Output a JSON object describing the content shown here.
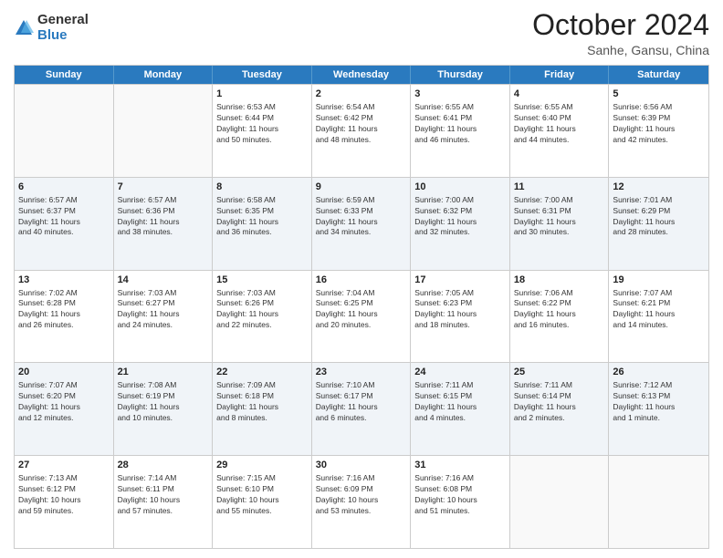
{
  "header": {
    "logo_general": "General",
    "logo_blue": "Blue",
    "month": "October 2024",
    "location": "Sanhe, Gansu, China"
  },
  "weekdays": [
    "Sunday",
    "Monday",
    "Tuesday",
    "Wednesday",
    "Thursday",
    "Friday",
    "Saturday"
  ],
  "rows": [
    [
      {
        "day": "",
        "lines": [],
        "empty": true
      },
      {
        "day": "",
        "lines": [],
        "empty": true
      },
      {
        "day": "1",
        "lines": [
          "Sunrise: 6:53 AM",
          "Sunset: 6:44 PM",
          "Daylight: 11 hours",
          "and 50 minutes."
        ]
      },
      {
        "day": "2",
        "lines": [
          "Sunrise: 6:54 AM",
          "Sunset: 6:42 PM",
          "Daylight: 11 hours",
          "and 48 minutes."
        ]
      },
      {
        "day": "3",
        "lines": [
          "Sunrise: 6:55 AM",
          "Sunset: 6:41 PM",
          "Daylight: 11 hours",
          "and 46 minutes."
        ]
      },
      {
        "day": "4",
        "lines": [
          "Sunrise: 6:55 AM",
          "Sunset: 6:40 PM",
          "Daylight: 11 hours",
          "and 44 minutes."
        ]
      },
      {
        "day": "5",
        "lines": [
          "Sunrise: 6:56 AM",
          "Sunset: 6:39 PM",
          "Daylight: 11 hours",
          "and 42 minutes."
        ]
      }
    ],
    [
      {
        "day": "6",
        "lines": [
          "Sunrise: 6:57 AM",
          "Sunset: 6:37 PM",
          "Daylight: 11 hours",
          "and 40 minutes."
        ]
      },
      {
        "day": "7",
        "lines": [
          "Sunrise: 6:57 AM",
          "Sunset: 6:36 PM",
          "Daylight: 11 hours",
          "and 38 minutes."
        ]
      },
      {
        "day": "8",
        "lines": [
          "Sunrise: 6:58 AM",
          "Sunset: 6:35 PM",
          "Daylight: 11 hours",
          "and 36 minutes."
        ]
      },
      {
        "day": "9",
        "lines": [
          "Sunrise: 6:59 AM",
          "Sunset: 6:33 PM",
          "Daylight: 11 hours",
          "and 34 minutes."
        ]
      },
      {
        "day": "10",
        "lines": [
          "Sunrise: 7:00 AM",
          "Sunset: 6:32 PM",
          "Daylight: 11 hours",
          "and 32 minutes."
        ]
      },
      {
        "day": "11",
        "lines": [
          "Sunrise: 7:00 AM",
          "Sunset: 6:31 PM",
          "Daylight: 11 hours",
          "and 30 minutes."
        ]
      },
      {
        "day": "12",
        "lines": [
          "Sunrise: 7:01 AM",
          "Sunset: 6:29 PM",
          "Daylight: 11 hours",
          "and 28 minutes."
        ]
      }
    ],
    [
      {
        "day": "13",
        "lines": [
          "Sunrise: 7:02 AM",
          "Sunset: 6:28 PM",
          "Daylight: 11 hours",
          "and 26 minutes."
        ]
      },
      {
        "day": "14",
        "lines": [
          "Sunrise: 7:03 AM",
          "Sunset: 6:27 PM",
          "Daylight: 11 hours",
          "and 24 minutes."
        ]
      },
      {
        "day": "15",
        "lines": [
          "Sunrise: 7:03 AM",
          "Sunset: 6:26 PM",
          "Daylight: 11 hours",
          "and 22 minutes."
        ]
      },
      {
        "day": "16",
        "lines": [
          "Sunrise: 7:04 AM",
          "Sunset: 6:25 PM",
          "Daylight: 11 hours",
          "and 20 minutes."
        ]
      },
      {
        "day": "17",
        "lines": [
          "Sunrise: 7:05 AM",
          "Sunset: 6:23 PM",
          "Daylight: 11 hours",
          "and 18 minutes."
        ]
      },
      {
        "day": "18",
        "lines": [
          "Sunrise: 7:06 AM",
          "Sunset: 6:22 PM",
          "Daylight: 11 hours",
          "and 16 minutes."
        ]
      },
      {
        "day": "19",
        "lines": [
          "Sunrise: 7:07 AM",
          "Sunset: 6:21 PM",
          "Daylight: 11 hours",
          "and 14 minutes."
        ]
      }
    ],
    [
      {
        "day": "20",
        "lines": [
          "Sunrise: 7:07 AM",
          "Sunset: 6:20 PM",
          "Daylight: 11 hours",
          "and 12 minutes."
        ]
      },
      {
        "day": "21",
        "lines": [
          "Sunrise: 7:08 AM",
          "Sunset: 6:19 PM",
          "Daylight: 11 hours",
          "and 10 minutes."
        ]
      },
      {
        "day": "22",
        "lines": [
          "Sunrise: 7:09 AM",
          "Sunset: 6:18 PM",
          "Daylight: 11 hours",
          "and 8 minutes."
        ]
      },
      {
        "day": "23",
        "lines": [
          "Sunrise: 7:10 AM",
          "Sunset: 6:17 PM",
          "Daylight: 11 hours",
          "and 6 minutes."
        ]
      },
      {
        "day": "24",
        "lines": [
          "Sunrise: 7:11 AM",
          "Sunset: 6:15 PM",
          "Daylight: 11 hours",
          "and 4 minutes."
        ]
      },
      {
        "day": "25",
        "lines": [
          "Sunrise: 7:11 AM",
          "Sunset: 6:14 PM",
          "Daylight: 11 hours",
          "and 2 minutes."
        ]
      },
      {
        "day": "26",
        "lines": [
          "Sunrise: 7:12 AM",
          "Sunset: 6:13 PM",
          "Daylight: 11 hours",
          "and 1 minute."
        ]
      }
    ],
    [
      {
        "day": "27",
        "lines": [
          "Sunrise: 7:13 AM",
          "Sunset: 6:12 PM",
          "Daylight: 10 hours",
          "and 59 minutes."
        ]
      },
      {
        "day": "28",
        "lines": [
          "Sunrise: 7:14 AM",
          "Sunset: 6:11 PM",
          "Daylight: 10 hours",
          "and 57 minutes."
        ]
      },
      {
        "day": "29",
        "lines": [
          "Sunrise: 7:15 AM",
          "Sunset: 6:10 PM",
          "Daylight: 10 hours",
          "and 55 minutes."
        ]
      },
      {
        "day": "30",
        "lines": [
          "Sunrise: 7:16 AM",
          "Sunset: 6:09 PM",
          "Daylight: 10 hours",
          "and 53 minutes."
        ]
      },
      {
        "day": "31",
        "lines": [
          "Sunrise: 7:16 AM",
          "Sunset: 6:08 PM",
          "Daylight: 10 hours",
          "and 51 minutes."
        ]
      },
      {
        "day": "",
        "lines": [],
        "empty": true
      },
      {
        "day": "",
        "lines": [],
        "empty": true
      }
    ]
  ]
}
